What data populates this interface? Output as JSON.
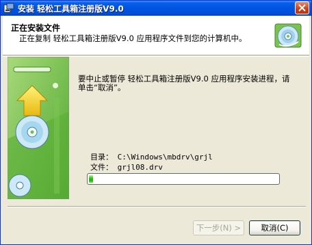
{
  "window": {
    "title": "安装 轻松工具箱注册版V9.0"
  },
  "header": {
    "title": "正在安装文件",
    "description": "正在复制 轻松工具箱注册版V9.0 应用程序文件到您的计算机中。"
  },
  "main": {
    "message": "要中止或暂停 轻松工具箱注册版V9.0 应用程序安装进程，请单击“取消”。",
    "directory_line": "目录： C:\\Windows\\mbdrv\\grjl",
    "file_line": "文件： grjl08.drv",
    "progress_percent": 2
  },
  "buttons": {
    "next_label": "下一步(N) >",
    "cancel_label": "取消(C)"
  },
  "colors": {
    "titlebar": "#0054E3",
    "panel_green": "#6CC24A",
    "progress_green": "#2FC21A",
    "arrow_yellow": "#F6D32C"
  },
  "icons": {
    "title": "installer-icon",
    "header": "cd-disc-icon",
    "close": "close-icon"
  }
}
